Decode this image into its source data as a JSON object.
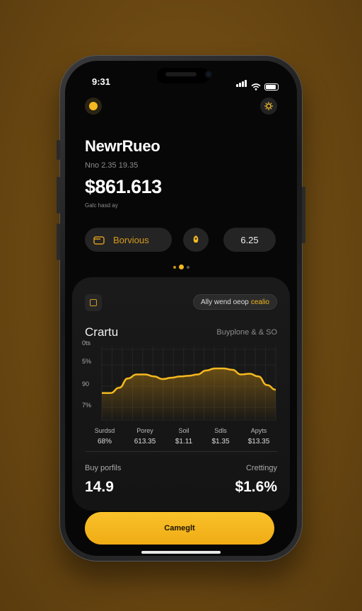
{
  "status": {
    "time": "9:31"
  },
  "header": {
    "title": "NewrRueo",
    "subtitle": "Nno 2.35 19.35",
    "balance": "$861.613",
    "caption": "Galc hasd ay"
  },
  "pills": {
    "main_label": "Borvious",
    "value": "6.25"
  },
  "card": {
    "badge_text": "Ally wend oeop",
    "badge_accent": "cealio",
    "title": "Crartu",
    "right_text": "Buyplone & & SO",
    "chart_data": {
      "type": "area",
      "y_ticks": [
        "0ts",
        "5%",
        "90",
        "7%"
      ],
      "y_values": [
        0.3,
        0.3,
        0.38,
        0.52,
        0.58,
        0.58,
        0.55,
        0.51,
        0.53,
        0.55,
        0.56,
        0.58,
        0.64,
        0.67,
        0.67,
        0.65,
        0.58,
        0.59,
        0.55,
        0.42,
        0.35
      ],
      "line_color": "#f5b91f"
    },
    "columns": [
      {
        "label": "Surdsd",
        "value": "68%"
      },
      {
        "label": "Porey",
        "value": "613.35"
      },
      {
        "label": "Soil",
        "value": "$1.11"
      },
      {
        "label": "Sdls",
        "value": "$1.35"
      },
      {
        "label": "Apyts",
        "value": "$13.35"
      }
    ],
    "footer": {
      "left_label": "Buy porfils",
      "right_label": "Crettingy",
      "left_value": "14.9",
      "right_value": "$1.6%"
    }
  },
  "cta_label": "Cameglt",
  "colors": {
    "accent": "#f5b91f",
    "background": "#070707"
  },
  "icons": [
    "coin-icon",
    "settings-icon",
    "wallet-icon",
    "rocket-icon",
    "square-icon"
  ]
}
